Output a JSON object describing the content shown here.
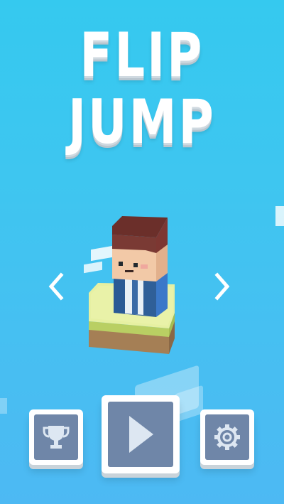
{
  "game": {
    "title_line_1": "FLIP",
    "title_line_2": "JUMP"
  },
  "controls": {
    "prev_character_icon": "chevron-left-icon",
    "next_character_icon": "chevron-right-icon"
  },
  "menu": {
    "leaderboard_icon": "trophy-icon",
    "play_icon": "play-icon",
    "settings_icon": "gear-icon"
  },
  "colors": {
    "sky_top": "#35c9ef",
    "sky_bottom": "#4db9f3",
    "button_face": "#ffffff",
    "button_inner": "#6f86a8",
    "icon_fill": "#dde7f2"
  }
}
